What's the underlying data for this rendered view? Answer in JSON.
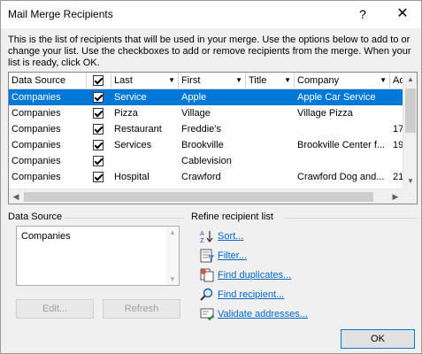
{
  "window": {
    "title": "Mail Merge Recipients",
    "help_glyph": "?",
    "close_glyph": "✕"
  },
  "description": "This is the list of recipients that will be used in your merge.  Use the options below to add to or change your list.  Use the checkboxes to add or remove recipients from the merge.  When your list is ready, click OK.",
  "table": {
    "headers": {
      "data_source": "Data Source",
      "last": "Last",
      "first": "First",
      "title": "Title",
      "company": "Company",
      "address": "Ad"
    },
    "rows": [
      {
        "source": "Companies",
        "checked": true,
        "last": "Service",
        "first": "Apple",
        "title": "",
        "company": "Apple Car Service",
        "address": "",
        "selected": true
      },
      {
        "source": "Companies",
        "checked": true,
        "last": "Pizza",
        "first": "Village",
        "title": "",
        "company": "Village Pizza",
        "address": "",
        "selected": false
      },
      {
        "source": "Companies",
        "checked": true,
        "last": "Restaurant",
        "first": "Freddie's",
        "title": "",
        "company": "",
        "address": "17",
        "selected": false
      },
      {
        "source": "Companies",
        "checked": true,
        "last": "Services",
        "first": "Brookville",
        "title": "",
        "company": "Brookville Center f...",
        "address": "19",
        "selected": false
      },
      {
        "source": "Companies",
        "checked": true,
        "last": "",
        "first": "Cablevision",
        "title": "",
        "company": "",
        "address": "",
        "selected": false
      },
      {
        "source": "Companies",
        "checked": true,
        "last": "Hospital",
        "first": "Crawford",
        "title": "",
        "company": "Crawford Dog and...",
        "address": "21",
        "selected": false
      }
    ]
  },
  "data_source_group": {
    "label": "Data Source",
    "items": [
      "Companies"
    ],
    "edit_label": "Edit...",
    "refresh_label": "Refresh"
  },
  "refine_group": {
    "label": "Refine recipient list",
    "links": [
      {
        "label": "Sort...",
        "icon": "sort-az-icon"
      },
      {
        "label": "Filter...",
        "icon": "filter-icon"
      },
      {
        "label": "Find duplicates...",
        "icon": "find-duplicates-icon"
      },
      {
        "label": "Find recipient...",
        "icon": "find-recipient-icon"
      },
      {
        "label": "Validate addresses...",
        "icon": "validate-addresses-icon"
      }
    ]
  },
  "ok_label": "OK",
  "colors": {
    "selection": "#0078d7",
    "link": "#0066cc",
    "dialog_bg": "#f0f0f0"
  }
}
